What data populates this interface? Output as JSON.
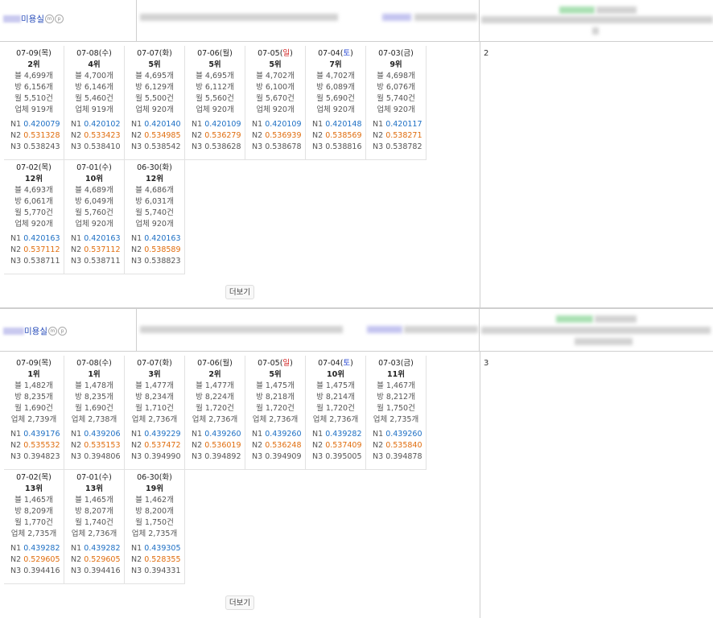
{
  "sections": [
    {
      "shop_name": "미용실",
      "rank_position": "2",
      "more_label": "더보기",
      "days": [
        {
          "date": "07-09(",
          "dow": "목",
          "rank": "2위",
          "blog": "블 4,699개",
          "bang": "방 6,156개",
          "month": "월 5,510건",
          "biz": "업체 919개",
          "n1": "0.420079",
          "n2": "0.531328",
          "n3": "0.538243"
        },
        {
          "date": "07-08(",
          "dow": "수",
          "rank": "4위",
          "blog": "블 4,700개",
          "bang": "방 6,146개",
          "month": "월 5,460건",
          "biz": "업체 919개",
          "n1": "0.420102",
          "n2": "0.533423",
          "n3": "0.538410"
        },
        {
          "date": "07-07(",
          "dow": "화",
          "rank": "5위",
          "blog": "블 4,695개",
          "bang": "방 6,129개",
          "month": "월 5,500건",
          "biz": "업체 920개",
          "n1": "0.420140",
          "n2": "0.534985",
          "n3": "0.538542"
        },
        {
          "date": "07-06(",
          "dow": "월",
          "rank": "5위",
          "blog": "블 4,695개",
          "bang": "방 6,112개",
          "month": "월 5,560건",
          "biz": "업체 920개",
          "n1": "0.420109",
          "n2": "0.536279",
          "n3": "0.538628"
        },
        {
          "date": "07-05(",
          "dow": "일",
          "rank": "5위",
          "blog": "블 4,702개",
          "bang": "방 6,100개",
          "month": "월 5,670건",
          "biz": "업체 920개",
          "n1": "0.420109",
          "n2": "0.536939",
          "n3": "0.538678"
        },
        {
          "date": "07-04(",
          "dow": "토",
          "rank": "7위",
          "blog": "블 4,702개",
          "bang": "방 6,089개",
          "month": "월 5,690건",
          "biz": "업체 920개",
          "n1": "0.420148",
          "n2": "0.538569",
          "n3": "0.538816"
        },
        {
          "date": "07-03(",
          "dow": "금",
          "rank": "9위",
          "blog": "블 4,698개",
          "bang": "방 6,076개",
          "month": "월 5,740건",
          "biz": "업체 920개",
          "n1": "0.420117",
          "n2": "0.538271",
          "n3": "0.538782"
        },
        {
          "date": "07-02(",
          "dow": "목",
          "rank": "12위",
          "blog": "블 4,693개",
          "bang": "방 6,061개",
          "month": "월 5,770건",
          "biz": "업체 920개",
          "n1": "0.420163",
          "n2": "0.537112",
          "n3": "0.538711"
        },
        {
          "date": "07-01(",
          "dow": "수",
          "rank": "10위",
          "blog": "블 4,689개",
          "bang": "방 6,049개",
          "month": "월 5,760건",
          "biz": "업체 920개",
          "n1": "0.420163",
          "n2": "0.537112",
          "n3": "0.538711"
        },
        {
          "date": "06-30(",
          "dow": "화",
          "rank": "12위",
          "blog": "블 4,686개",
          "bang": "방 6,031개",
          "month": "월 5,740건",
          "biz": "업체 920개",
          "n1": "0.420163",
          "n2": "0.538589",
          "n3": "0.538823"
        }
      ]
    },
    {
      "shop_name": "미용실",
      "rank_position": "3",
      "more_label": "더보기",
      "days": [
        {
          "date": "07-09(",
          "dow": "목",
          "rank": "1위",
          "blog": "블 1,482개",
          "bang": "방 8,235개",
          "month": "월 1,690건",
          "biz": "업체 2,739개",
          "n1": "0.439176",
          "n2": "0.535532",
          "n3": "0.394823"
        },
        {
          "date": "07-08(",
          "dow": "수",
          "rank": "1위",
          "blog": "블 1,478개",
          "bang": "방 8,235개",
          "month": "월 1,690건",
          "biz": "업체 2,738개",
          "n1": "0.439206",
          "n2": "0.535153",
          "n3": "0.394806"
        },
        {
          "date": "07-07(",
          "dow": "화",
          "rank": "3위",
          "blog": "블 1,477개",
          "bang": "방 8,234개",
          "month": "월 1,710건",
          "biz": "업체 2,736개",
          "n1": "0.439229",
          "n2": "0.537472",
          "n3": "0.394990"
        },
        {
          "date": "07-06(",
          "dow": "월",
          "rank": "2위",
          "blog": "블 1,477개",
          "bang": "방 8,224개",
          "month": "월 1,720건",
          "biz": "업체 2,736개",
          "n1": "0.439260",
          "n2": "0.536019",
          "n3": "0.394892"
        },
        {
          "date": "07-05(",
          "dow": "일",
          "rank": "5위",
          "blog": "블 1,475개",
          "bang": "방 8,218개",
          "month": "월 1,720건",
          "biz": "업체 2,736개",
          "n1": "0.439260",
          "n2": "0.536248",
          "n3": "0.394909"
        },
        {
          "date": "07-04(",
          "dow": "토",
          "rank": "10위",
          "blog": "블 1,475개",
          "bang": "방 8,214개",
          "month": "월 1,720건",
          "biz": "업체 2,736개",
          "n1": "0.439282",
          "n2": "0.537409",
          "n3": "0.395005"
        },
        {
          "date": "07-03(",
          "dow": "금",
          "rank": "11위",
          "blog": "블 1,467개",
          "bang": "방 8,212개",
          "month": "월 1,750건",
          "biz": "업체 2,735개",
          "n1": "0.439260",
          "n2": "0.535840",
          "n3": "0.394878"
        },
        {
          "date": "07-02(",
          "dow": "목",
          "rank": "13위",
          "blog": "블 1,465개",
          "bang": "방 8,209개",
          "month": "월 1,770건",
          "biz": "업체 2,735개",
          "n1": "0.439282",
          "n2": "0.529605",
          "n3": "0.394416"
        },
        {
          "date": "07-01(",
          "dow": "수",
          "rank": "13위",
          "blog": "블 1,465개",
          "bang": "방 8,207개",
          "month": "월 1,740건",
          "biz": "업체 2,736개",
          "n1": "0.439282",
          "n2": "0.529605",
          "n3": "0.394416"
        },
        {
          "date": "06-30(",
          "dow": "화",
          "rank": "19위",
          "blog": "블 1,462개",
          "bang": "방 8,200개",
          "month": "월 1,750건",
          "biz": "업체 2,735개",
          "n1": "0.439305",
          "n2": "0.528355",
          "n3": "0.394331"
        }
      ]
    }
  ],
  "labels": {
    "n1": "N1",
    "n2": "N2",
    "n3": "N3",
    "close_paren": ")",
    "badge_m": "m",
    "badge_p": "p"
  },
  "colors": {
    "n1": "#1d6fc4",
    "n2": "#e06d0e",
    "sunday": "#d01c1c",
    "saturday": "#1c3ed0",
    "shop_link": "#2147b8"
  }
}
